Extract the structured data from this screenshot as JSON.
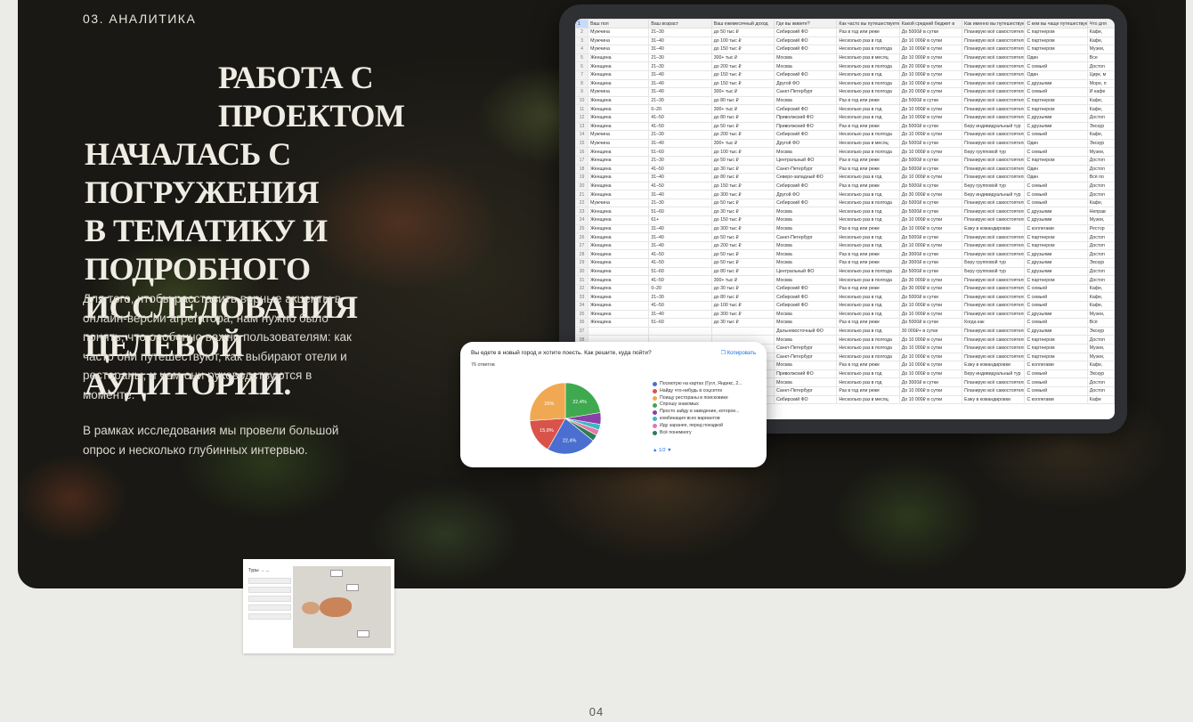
{
  "section_label": "03. АНАЛИТИКА",
  "headline": [
    "РАБОТА С ПРОЕКТОМ",
    "НАЧАЛАСЬ С ПОГРУЖЕНИЯ",
    "В ТЕМАТИКУ И ПОДРОБНОГО",
    "ИССЛЕДОВАНИЯ ЦЕЛЕВОЙ",
    "АУДИТОРИИ."
  ],
  "paragraph1": "Для того, чтобы расставить верные акценты в онлайн-версии агрегатора, нам нужно было понять, что особенно важно пользователям: как часто они путешествуют, как выбирают отели и рестораны, и чем они руководствуются в моменте.",
  "paragraph2": "В рамках исследования мы провели большой опрос и несколько глубинных интервью.",
  "sheet": {
    "headers": [
      "1",
      "Ваш пол",
      "Ваш возраст",
      "Ваш ежемесячный доход",
      "Где вы живете?",
      "Как часто вы путешествуете?",
      "Какой средний бюджет в",
      "Как именно вы путешествуете?",
      "С кем вы чаще путешествуете?",
      "Что для"
    ],
    "rows": [
      [
        "2",
        "Мужчина",
        "21–30",
        "до 50 тыс ₽",
        "Сибирский ФО",
        "Раз в год или реже",
        "До 5000₽ в сутки",
        "Планирую всё самостоятельно",
        "С партнером",
        "Кафе,"
      ],
      [
        "3",
        "Мужчина",
        "31–40",
        "до 100 тыс ₽",
        "Сибирский ФО",
        "Несколько раз в год",
        "До 10 000₽ в сутки",
        "Планирую всё самостоятельно",
        "С партнером",
        "Кафе,"
      ],
      [
        "4",
        "Мужчина",
        "31–40",
        "до 150 тыс ₽",
        "Сибирский ФО",
        "Несколько раз в полгода",
        "До 10 000₽ в сутки",
        "Планирую всё самостоятельно",
        "С партнером",
        "Музеи,"
      ],
      [
        "5",
        "Женщина",
        "21–30",
        "300+ тыс ₽",
        "Москва",
        "Несколько раз в месяц",
        "До 10 000₽ в сутки",
        "Планирую всё самостоятельно",
        "Один",
        "Все"
      ],
      [
        "6",
        "Женщина",
        "21–30",
        "до 200 тыс ₽",
        "Москва",
        "Несколько раз в полгода",
        "До 20 000₽ в сутки",
        "Планирую всё самостоятельно",
        "С семьей",
        "Достоп"
      ],
      [
        "7",
        "Женщина",
        "31–40",
        "до 150 тыс ₽",
        "Сибирский ФО",
        "Несколько раз в год",
        "До 10 000₽ в сутки",
        "Планирую всё самостоятельно",
        "Один",
        "Цирк, м"
      ],
      [
        "8",
        "Женщина",
        "31–40",
        "до 150 тыс ₽",
        "Другой ФО",
        "Несколько раз в полгода",
        "До 10 000₽ в сутки",
        "Планирую всё самостоятельно",
        "С друзьями",
        "Море, п"
      ],
      [
        "9",
        "Мужчина",
        "31–40",
        "300+ тыс ₽",
        "Санкт-Петербург",
        "Несколько раз в полгода",
        "До 20 000₽ в сутки",
        "Планирую всё самостоятельно",
        "С семьей",
        "И кафе"
      ],
      [
        "10",
        "Женщина",
        "21–30",
        "до 80 тыс ₽",
        "Москва",
        "Раз в год или реже",
        "До 5000₽ в сутки",
        "Планирую всё самостоятельно",
        "С партнером",
        "Кафе,"
      ],
      [
        "11",
        "Женщина",
        "0–20",
        "300+ тыс ₽",
        "Сибирский ФО",
        "Несколько раз в год",
        "До 10 000₽ в сутки",
        "Планирую всё самостоятельно",
        "С партнером",
        "Кафе,"
      ],
      [
        "12",
        "Женщина",
        "41–50",
        "до 80 тыс ₽",
        "Приволжский ФО",
        "Несколько раз в год",
        "До 10 000₽ в сутки",
        "Планирую всё самостоятельно",
        "С друзьями",
        "Достоп"
      ],
      [
        "13",
        "Женщина",
        "41–50",
        "до 50 тыс ₽",
        "Приволжский ФО",
        "Раз в год или реже",
        "До 5000₽ в сутки",
        "Беру индивидуальный тур",
        "С друзьями",
        "Экскур"
      ],
      [
        "14",
        "Мужчина",
        "21–30",
        "до 200 тыс ₽",
        "Сибирский ФО",
        "Несколько раз в полгода",
        "До 10 000₽ в сутки",
        "Планирую всё самостоятельно",
        "С семьей",
        "Кафе,"
      ],
      [
        "15",
        "Мужчина",
        "31–40",
        "300+ тыс ₽",
        "Другой ФО",
        "Несколько раз в месяц",
        "До 5000₽ в сутки",
        "Планирую всё самостоятельно",
        "Один",
        "Экскур"
      ],
      [
        "16",
        "Женщина",
        "51–60",
        "до 100 тыс ₽",
        "Москва",
        "Несколько раз в полгода",
        "До 10 000₽ в сутки",
        "Беру групповой тур",
        "С семьей",
        "Музеи,"
      ],
      [
        "17",
        "Женщина",
        "21–30",
        "до 50 тыс ₽",
        "Центральный ФО",
        "Раз в год или реже",
        "До 5000₽ в сутки",
        "Планирую всё самостоятельно",
        "С партнером",
        "Достоп"
      ],
      [
        "18",
        "Женщина",
        "41–50",
        "до 30 тыс ₽",
        "Санкт-Петербург",
        "Раз в год или реже",
        "До 5000₽ в сутки",
        "Планирую всё самостоятельно",
        "Один",
        "Достоп"
      ],
      [
        "19",
        "Женщина",
        "31–40",
        "до 80 тыс ₽",
        "Северо-западный ФО",
        "Несколько раз в год",
        "До 10 000₽ в сутки",
        "Планирую всё самостоятельно",
        "Один",
        "Всё по"
      ],
      [
        "20",
        "Женщина",
        "41–50",
        "до 150 тыс ₽",
        "Сибирский ФО",
        "Раз в год или реже",
        "До 5000₽ в сутки",
        "Беру групповой тур",
        "С семьей",
        "Достоп"
      ],
      [
        "21",
        "Женщина",
        "31–40",
        "до 300 тыс ₽",
        "Другой ФО",
        "Несколько раз в год",
        "До 30 000₽ в сутки",
        "Беру индивидуальный тур",
        "С семьей",
        "Достоп"
      ],
      [
        "22",
        "Мужчина",
        "21–30",
        "до 50 тыс ₽",
        "Сибирский ФО",
        "Несколько раз в полгода",
        "До 5000₽ в сутки",
        "Планирую всё самостоятельно",
        "С семьей",
        "Кафе,"
      ],
      [
        "23",
        "Женщина",
        "51–60",
        "до 30 тыс ₽",
        "Москва",
        "Несколько раз в год",
        "До 5000₽ в сутки",
        "Планирую всё самостоятельно",
        "С друзьями",
        "Неправ"
      ],
      [
        "24",
        "Женщина",
        "61+",
        "до 150 тыс ₽",
        "Москва",
        "Несколько раз в год",
        "До 10 000₽ в сутки",
        "Планирую всё самостоятельно",
        "С друзьями",
        "Музеи,"
      ],
      [
        "25",
        "Женщина",
        "31–40",
        "до 300 тыс ₽",
        "Москва",
        "Раз в год или реже",
        "До 10 000₽ в сутки",
        "Езжу в командировки",
        "С коллегами",
        "Рестор"
      ],
      [
        "26",
        "Женщина",
        "31–40",
        "до 50 тыс ₽",
        "Санкт-Петербург",
        "Несколько раз в год",
        "До 5000₽ в сутки",
        "Планирую всё самостоятельно",
        "С партнером",
        "Достоп"
      ],
      [
        "27",
        "Женщина",
        "31–40",
        "до 200 тыс ₽",
        "Москва",
        "Несколько раз в год",
        "До 10 000₽ в сутки",
        "Планирую всё самостоятельно",
        "С партнером",
        "Достоп"
      ],
      [
        "28",
        "Женщина",
        "41–50",
        "до 50 тыс ₽",
        "Москва",
        "Раз в год или реже",
        "До 3000₽ в сутки",
        "Планирую всё самостоятельно",
        "С друзьями",
        "Достоп"
      ],
      [
        "29",
        "Женщина",
        "41–50",
        "до 50 тыс ₽",
        "Москва",
        "Раз в год или реже",
        "До 3000₽ в сутки",
        "Беру групповой тур",
        "С друзьями",
        "Экскур"
      ],
      [
        "30",
        "Женщина",
        "51–60",
        "до 80 тыс ₽",
        "Центральный ФО",
        "Несколько раз в полгода",
        "До 5000₽ в сутки",
        "Беру групповой тур",
        "С друзьями",
        "Достоп"
      ],
      [
        "31",
        "Женщина",
        "41–50",
        "300+ тыс ₽",
        "Москва",
        "Несколько раз в полгода",
        "До 30 000₽ в сутки",
        "Планирую всё самостоятельно",
        "С партнером",
        "Достоп"
      ],
      [
        "32",
        "Женщина",
        "0–20",
        "до 30 тыс ₽",
        "Сибирский ФО",
        "Раз в год или реже",
        "До 30 000₽ в сутки",
        "Планирую всё самостоятельно",
        "С семьей",
        "Кафе,"
      ],
      [
        "33",
        "Женщина",
        "21–30",
        "до 80 тыс ₽",
        "Сибирский ФО",
        "Несколько раз в год",
        "До 5000₽ в сутки",
        "Планирую всё самостоятельно",
        "С семьей",
        "Кафе,"
      ],
      [
        "34",
        "Женщина",
        "41–50",
        "до 100 тыс ₽",
        "Сибирский ФО",
        "Несколько раз в год",
        "До 10 000₽ в сутки",
        "Планирую всё самостоятельно",
        "С семьей",
        "Кафе,"
      ],
      [
        "35",
        "Женщина",
        "31–40",
        "до 300 тыс ₽",
        "Москва",
        "Несколько раз в год",
        "До 10 000₽ в сутки",
        "Планирую всё самостоятельно",
        "С друзьями",
        "Музеи,"
      ],
      [
        "36",
        "Женщина",
        "51–60",
        "до 30 тыс ₽",
        "Москва",
        "Раз в год или реже",
        "До 5000₽ в сутки",
        "Когда как",
        "С семьей",
        "Всё"
      ],
      [
        "37",
        "",
        "",
        "",
        "Дальневосточный ФО",
        "Несколько раз в год",
        "30 000₽+ в сутки",
        "Планирую всё самостоятельно",
        "С друзьями",
        "Экскур"
      ],
      [
        "38",
        "",
        "",
        "",
        "Москва",
        "Несколько раз в полгода",
        "До 10 000₽ в сутки",
        "Планирую всё самостоятельно",
        "С партнером",
        "Достоп"
      ],
      [
        "39",
        "",
        "",
        "",
        "Санкт-Петербург",
        "Несколько раз в полгода",
        "До 10 000₽ в сутки",
        "Планирую всё самостоятельно",
        "С партнером",
        "Музеи,"
      ],
      [
        "40",
        "",
        "",
        "",
        "Санкт-Петербург",
        "Несколько раз в полгода",
        "До 10 000₽ в сутки",
        "Планирую всё самостоятельно",
        "С партнером",
        "Музеи,"
      ],
      [
        "41",
        "",
        "",
        "",
        "Москва",
        "Раз в год или реже",
        "До 10 000₽ в сутки",
        "Езжу в командировки",
        "С коллегами",
        "Кафе,"
      ],
      [
        "42",
        "",
        "",
        "",
        "Приволжский ФО",
        "Несколько раз в год",
        "До 10 000₽ в сутки",
        "Беру индивидуальный тур",
        "С семьей",
        "Экскур"
      ],
      [
        "43",
        "",
        "",
        "",
        "Москва",
        "Несколько раз в год",
        "До 3000₽ в сутки",
        "Планирую всё самостоятельно",
        "С семьей",
        "Достоп"
      ],
      [
        "44",
        "",
        "",
        "",
        "Санкт-Петербург",
        "Раз в год или реже",
        "До 10 000₽ в сутки",
        "Планирую всё самостоятельно",
        "С семьей",
        "Достоп"
      ],
      [
        "45",
        "",
        "",
        "",
        "Сибирский ФО",
        "Несколько раз в месяц",
        "До 10 000₽ в сутки",
        "Езжу в командировки",
        "С коллегами",
        "Кафе"
      ]
    ]
  },
  "poll": {
    "question": "Вы едете в новый город и хотите поесть. Как решите, куда пойти?",
    "copy_label": "Копировать",
    "responses": "76 ответов",
    "pager": "1/2"
  },
  "chart_data": {
    "type": "pie",
    "categories": [
      "Посмотрю на картах (Гугл, Яндекс, 2...",
      "Найду что-нибудь в соцсетях",
      "Поищу рестораны в поисковике",
      "Спрошу знакомых",
      "Просто зайду в заведение, которое...",
      "комбинация всех вариантов",
      "Иду заранее, перед поездкой",
      "Всё понемногу"
    ],
    "values": [
      22.4,
      15.8,
      26,
      22.4,
      5.3,
      2.6,
      2.6,
      2.9
    ],
    "data_labels": [
      "22,4%",
      "15,8%",
      "26%",
      "22,4%",
      "",
      "",
      "",
      ""
    ],
    "colors": [
      "#4a6fd1",
      "#d9534a",
      "#f0a952",
      "#3fa94f",
      "#8b3fa9",
      "#3fb7c4",
      "#e07aa8",
      "#2e7d4f"
    ]
  },
  "thumbnail": {
    "title": "Туры → ...",
    "items": [
      "",
      "",
      "",
      "",
      ""
    ]
  },
  "page_number": "04"
}
